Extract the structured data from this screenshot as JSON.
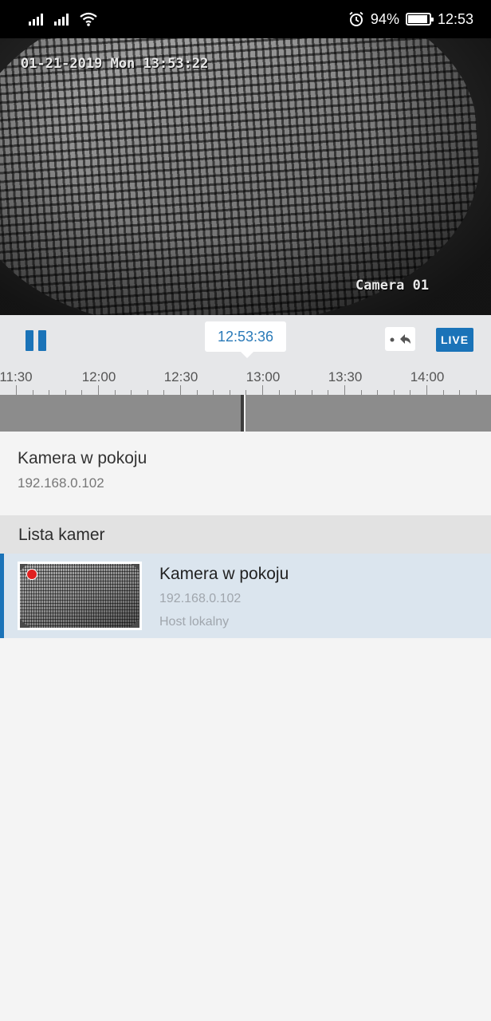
{
  "status_bar": {
    "battery_percent": "94%",
    "battery_level": 0.94,
    "time": "12:53",
    "icons": [
      "signal-icon",
      "signal-icon",
      "wifi-icon",
      "alarm-icon",
      "battery-icon"
    ]
  },
  "video": {
    "osd_datetime": "01-21-2019 Mon 13:53:22",
    "osd_camera": "Camera 01"
  },
  "controls": {
    "current_time": "12:53:36",
    "live_label": "LIVE",
    "accent_color": "#1a73b8",
    "ticks": [
      "11:30",
      "12:00",
      "12:30",
      "13:00",
      "13:30",
      "14:00"
    ]
  },
  "current_camera": {
    "name": "Kamera w pokoju",
    "ip": "192.168.0.102"
  },
  "camera_list": {
    "title": "Lista kamer",
    "items": [
      {
        "name": "Kamera w pokoju",
        "ip": "192.168.0.102",
        "host": "Host lokalny",
        "recording": true
      }
    ]
  }
}
